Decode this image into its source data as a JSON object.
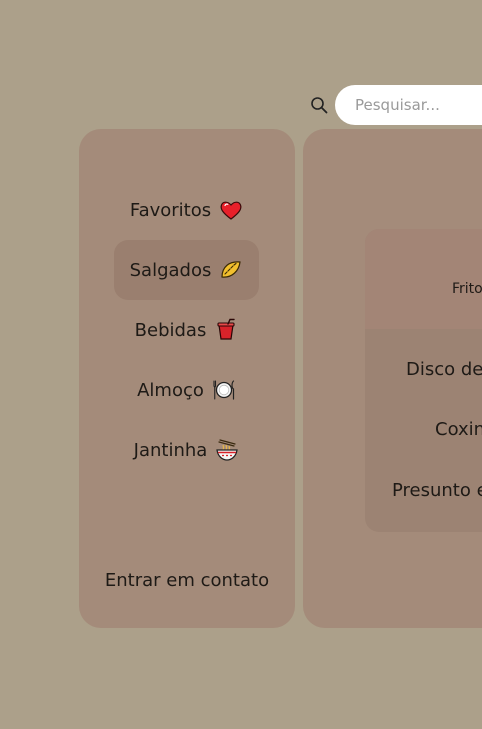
{
  "search": {
    "placeholder": "Pesquisar..."
  },
  "sidebar": {
    "items": [
      {
        "label": "Favoritos",
        "icon": "heart-icon"
      },
      {
        "label": "Salgados",
        "icon": "pastry-icon",
        "active": true
      },
      {
        "label": "Bebidas",
        "icon": "drink-cup-icon"
      },
      {
        "label": "Almoço",
        "icon": "plate-cutlery-icon"
      },
      {
        "label": "Jantinha",
        "icon": "noodle-bowl-icon"
      }
    ],
    "contact_label": "Entrar em contato"
  },
  "content": {
    "card": {
      "subtitle": "Frito",
      "items": [
        "Disco de",
        "Coxin",
        "Presunto e"
      ]
    }
  },
  "colors": {
    "background": "#aca08a",
    "panel": "#a48b7a",
    "active_item": "#9a7f6f",
    "card": "#9c8373",
    "card_header": "#a38576"
  }
}
